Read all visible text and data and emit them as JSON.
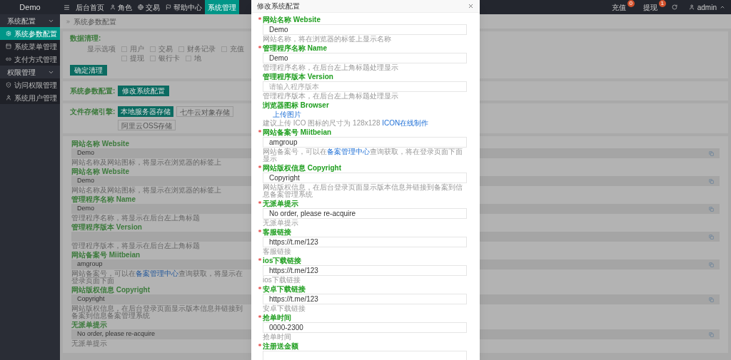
{
  "sidebar": {
    "logo": "Demo",
    "groups": [
      {
        "label": "系统配置",
        "expanded": true,
        "items": [
          {
            "label": "系统参数配置",
            "selected": true
          },
          {
            "label": "系统菜单管理",
            "selected": false
          },
          {
            "label": "支付方式管理",
            "selected": false
          }
        ]
      },
      {
        "label": "权限管理",
        "expanded": true,
        "items": [
          {
            "label": "访问权限管理",
            "selected": false
          },
          {
            "label": "系统用户管理",
            "selected": false
          }
        ]
      }
    ]
  },
  "topbar": {
    "tabs": [
      {
        "label": "后台首页",
        "selected": false
      },
      {
        "label": "角色",
        "selected": false
      },
      {
        "label": "交易",
        "selected": false
      },
      {
        "label": "帮助中心",
        "selected": false
      },
      {
        "label": "系统管理",
        "selected": true
      }
    ],
    "alerts": [
      {
        "label": "充值",
        "badge": "0"
      },
      {
        "label": "提现",
        "badge": "1"
      }
    ],
    "user": "admin"
  },
  "breadcrumb": "系统参数配置",
  "cleanup": {
    "label": "数据清理:",
    "options_label": "显示选项",
    "options": [
      {
        "label": "用户",
        "checked": false
      },
      {
        "label": "交易",
        "checked": false
      },
      {
        "label": "财务记录",
        "checked": false
      },
      {
        "label": "充值",
        "checked": false
      },
      {
        "label": "提现",
        "checked": false
      },
      {
        "label": "银行卡",
        "checked": false
      },
      {
        "label": "地",
        "checked": false
      }
    ],
    "button": "确定清理"
  },
  "sys_config": {
    "label": "系统参数配置:",
    "button": "修改系统配置"
  },
  "storage": {
    "label": "文件存储引擎:",
    "options": [
      {
        "label": "本地服务器存储",
        "selected": true
      },
      {
        "label": "七牛云对象存储",
        "selected": false
      },
      {
        "label": "阿里云OSS存储",
        "selected": false
      }
    ]
  },
  "settings_form": {
    "fields": [
      {
        "label": "网站名称 Website",
        "value": "Demo",
        "help": [
          {
            "kind": "text",
            "text": "网站名称及网站图标，将显示在浏览器的标签上"
          }
        ]
      },
      {
        "label": "网站名称 Website",
        "value": "Demo",
        "help": [
          {
            "kind": "text",
            "text": "网站名称及网站图标，将显示在浏览器的标签上"
          }
        ]
      },
      {
        "label": "管理程序名称 Name",
        "value": "Demo",
        "help": [
          {
            "kind": "text",
            "text": "管理程序名称，将显示在后台左上角标题"
          }
        ]
      },
      {
        "label": "管理程序版本 Version",
        "help": [
          {
            "kind": "text",
            "text": "管理程序版本，将显示在后台左上角标题"
          }
        ]
      },
      {
        "label": "网站备案号 Miitbeian",
        "value": "amgroup",
        "help": [
          {
            "kind": "text",
            "text": "网站备案号，可以在"
          },
          {
            "kind": "link",
            "text": "备案管理中心"
          },
          {
            "kind": "text",
            "text": "查询获取，将显示在登录页面下面"
          }
        ]
      },
      {
        "label": "网站版权信息 Copyright",
        "value": "Copyright",
        "help": [
          {
            "kind": "text",
            "text": "网站版权信息，在后台登录页面显示版本信息并链接到备案到信息备案管理系统"
          }
        ]
      },
      {
        "label": "无派单提示",
        "value": "No order, please re-acquire",
        "help": [
          {
            "kind": "text",
            "text": "无派单提示"
          }
        ]
      }
    ]
  },
  "modal": {
    "title": "修改系统配置",
    "fields": [
      {
        "kind": "input",
        "required": true,
        "label": "网站名称 Website",
        "value": "Demo",
        "help": [
          {
            "kind": "text",
            "text": "网站名称，将在浏览器的标签上显示名称"
          }
        ]
      },
      {
        "kind": "input",
        "required": true,
        "label": "管理程序名称 Name",
        "value": "Demo",
        "help": [
          {
            "kind": "text",
            "text": "管理程序名称，在后台左上角标题处理显示"
          }
        ]
      },
      {
        "kind": "input",
        "required": false,
        "label": "管理程序版本 Version",
        "placeholder": "请输入程序版本",
        "help": [
          {
            "kind": "text",
            "text": "管理程序版本，在后台左上角标题处理显示"
          }
        ]
      },
      {
        "kind": "upload",
        "required": false,
        "label": "浏览器图标 Browser",
        "upload": "上传图片",
        "help": [
          {
            "kind": "text",
            "text": "建议上传 ICO 图标的尺寸为 128x128 "
          },
          {
            "kind": "link",
            "text": "ICON在线制作"
          }
        ]
      },
      {
        "kind": "input",
        "required": true,
        "label": "网站备案号 Miitbeian",
        "value": "amgroup",
        "help": [
          {
            "kind": "text",
            "text": "网站备案号，可以在"
          },
          {
            "kind": "link",
            "text": "备案管理中心"
          },
          {
            "kind": "text",
            "text": "查询获取，将在登录页面下面显示"
          }
        ]
      },
      {
        "kind": "input",
        "required": true,
        "label": "网站版权信息 Copyright",
        "value": "Copyright",
        "help": [
          {
            "kind": "text",
            "text": "网站版权信息，在后台登录页面显示版本信息并链接到备案到信息备案管理系统"
          }
        ]
      },
      {
        "kind": "input",
        "required": true,
        "label": "无派单提示",
        "value": "No order, please re-acquire",
        "help": [
          {
            "kind": "text",
            "text": "无派单提示"
          }
        ]
      },
      {
        "kind": "input",
        "required": true,
        "label": "客服链接",
        "value": "https://t.me/123",
        "help": [
          {
            "kind": "text",
            "text": "客服链接"
          }
        ]
      },
      {
        "kind": "input",
        "required": true,
        "label": "ios下载链接",
        "value": "https://t.me/123",
        "help": [
          {
            "kind": "text",
            "text": "ios下载链接"
          }
        ]
      },
      {
        "kind": "input",
        "required": true,
        "label": "安卓下载链接",
        "value": "https://t.me/123",
        "help": [
          {
            "kind": "text",
            "text": "安卓下载链接"
          }
        ]
      },
      {
        "kind": "input",
        "required": true,
        "label": "抢单时间",
        "value": "0000-2300",
        "help": [
          {
            "kind": "text",
            "text": "抢单时间"
          }
        ]
      },
      {
        "kind": "input",
        "required": true,
        "label": "注册送金额"
      }
    ]
  }
}
